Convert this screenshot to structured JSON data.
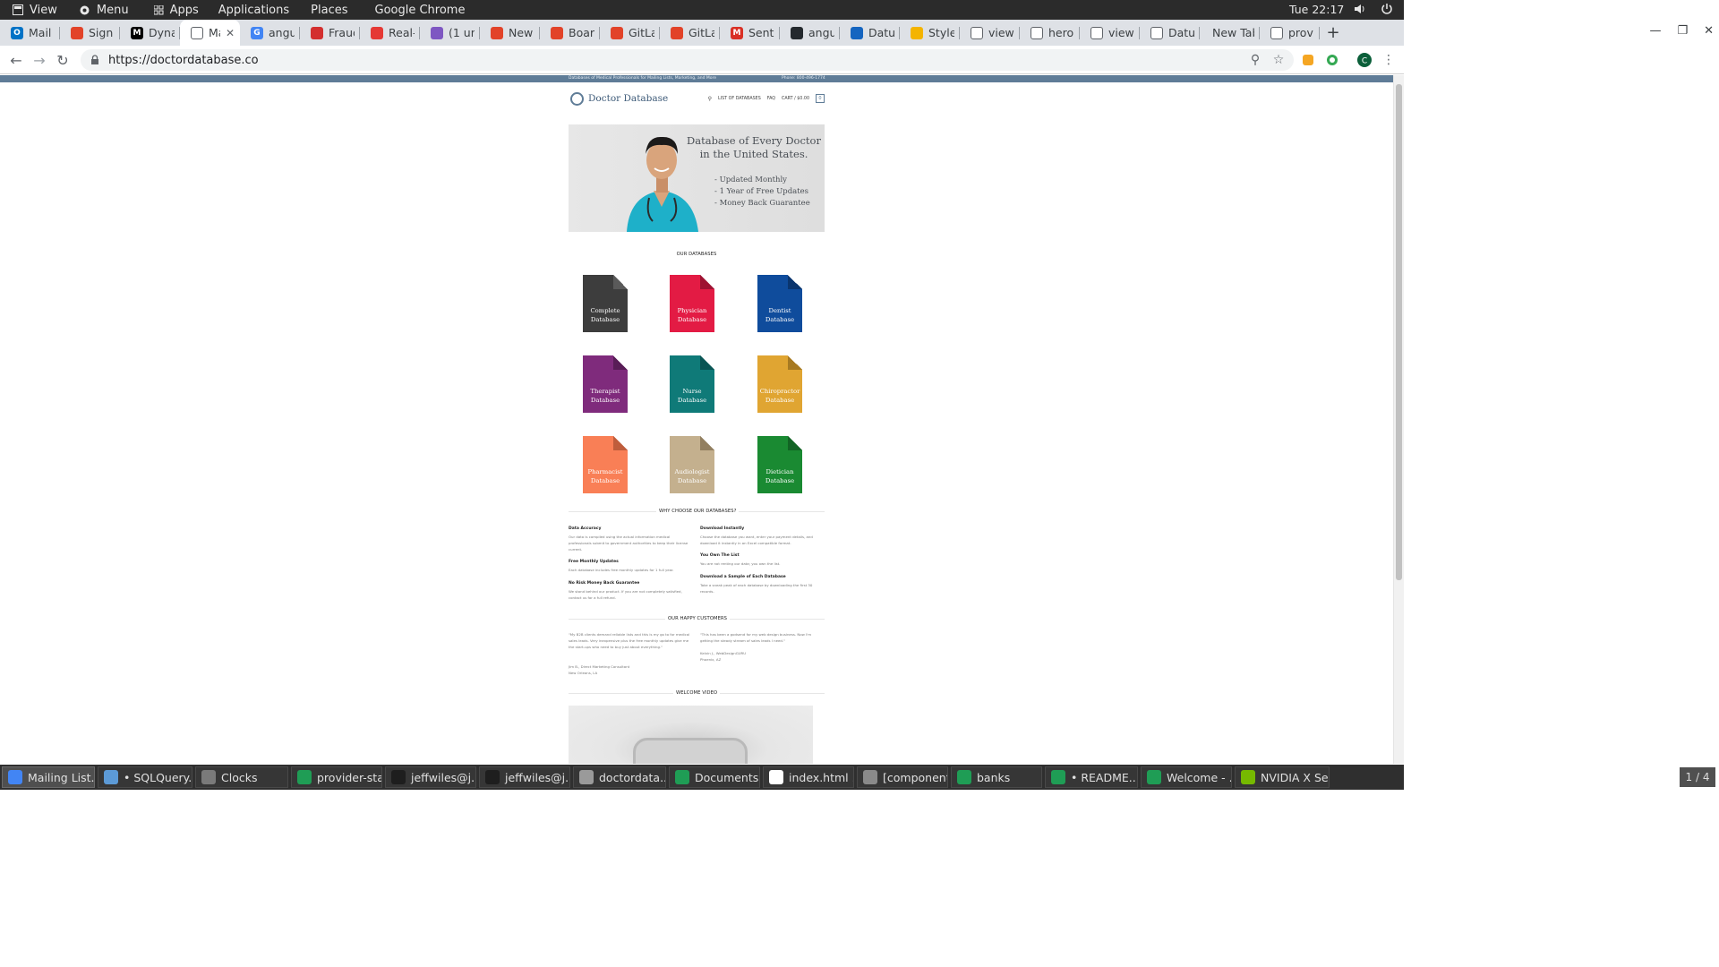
{
  "system_panel": {
    "items": [
      "View",
      "Menu",
      "Apps",
      "Applications",
      "Places",
      "Google Chrome"
    ],
    "clock": "Tue 22:17"
  },
  "tabs": [
    {
      "title": "Mail -",
      "color": "#0072c6",
      "glyph": "O"
    },
    {
      "title": "Sign u",
      "color": "#e24329",
      "glyph": ""
    },
    {
      "title": "Dynar",
      "color": "#000000",
      "glyph": "M"
    },
    {
      "title": "Ma",
      "color": "#ffffff",
      "glyph": "",
      "active": true
    },
    {
      "title": "angul",
      "color": "#4285f4",
      "glyph": "G"
    },
    {
      "title": "Fraud",
      "color": "#d32f2f",
      "glyph": ""
    },
    {
      "title": "Real-\\",
      "color": "#e53935",
      "glyph": ""
    },
    {
      "title": "(1 unr",
      "color": "#7e57c2",
      "glyph": ""
    },
    {
      "title": "New S",
      "color": "#e24329",
      "glyph": ""
    },
    {
      "title": "Board",
      "color": "#e24329",
      "glyph": ""
    },
    {
      "title": "GitLal",
      "color": "#e24329",
      "glyph": ""
    },
    {
      "title": "GitLal",
      "color": "#e24329",
      "glyph": ""
    },
    {
      "title": "Sent I",
      "color": "#d93025",
      "glyph": "M"
    },
    {
      "title": "angul",
      "color": "#24292e",
      "glyph": ""
    },
    {
      "title": "Datun",
      "color": "#1565c0",
      "glyph": ""
    },
    {
      "title": "Style",
      "color": "#f4b400",
      "glyph": ""
    },
    {
      "title": "view-",
      "color": "#ffffff",
      "glyph": ""
    },
    {
      "title": "hero-",
      "color": "#ffffff",
      "glyph": ""
    },
    {
      "title": "view-",
      "color": "#ffffff",
      "glyph": ""
    },
    {
      "title": "Datun",
      "color": "#ffffff",
      "glyph": ""
    },
    {
      "title": "New Tab",
      "color": "none",
      "glyph": ""
    },
    {
      "title": "provic",
      "color": "#ffffff",
      "glyph": ""
    }
  ],
  "omnibox": {
    "url": "https://doctordatabase.co"
  },
  "site": {
    "topbar_left": "Databases of Medical Professionals for Mailing Lists, Marketing, and More",
    "topbar_right": "Phone: 800-496-1774",
    "logo": "Doctor Database",
    "nav": [
      "LIST OF DATABASES",
      "FAQ",
      "CART / $0.00"
    ],
    "cart_count": "0",
    "hero": {
      "title": "Database of Every Doctor in the United States.",
      "bullets": [
        "- Updated Monthly",
        "- 1 Year of Free Updates",
        "- Money Back Guarantee"
      ]
    },
    "our_databases_title": "OUR DATABASES",
    "databases": [
      {
        "line1": "Complete",
        "line2": "Database",
        "color": "#3d3d3d",
        "shade": "#5a5a5a"
      },
      {
        "line1": "Physician",
        "line2": "Database",
        "color": "#e31b44",
        "shade": "#9e1232"
      },
      {
        "line1": "Dentist",
        "line2": "Database",
        "color": "#0f4c9c",
        "shade": "#0a356e"
      },
      {
        "line1": "Therapist",
        "line2": "Database",
        "color": "#7f2b7c",
        "shade": "#591d57"
      },
      {
        "line1": "Nurse",
        "line2": "Database",
        "color": "#0f7a78",
        "shade": "#0a5554"
      },
      {
        "line1": "Chiropractor",
        "line2": "Database",
        "color": "#e0a532",
        "shade": "#a77a22"
      },
      {
        "line1": "Pharmacist",
        "line2": "Database",
        "color": "#f97f56",
        "shade": "#bf5d3c"
      },
      {
        "line1": "Audiologist",
        "line2": "Database",
        "color": "#c4b08e",
        "shade": "#927f60"
      },
      {
        "line1": "Dietician",
        "line2": "Database",
        "color": "#1a8a32",
        "shade": "#126424"
      }
    ],
    "why_title": "WHY CHOOSE OUR DATABASES?",
    "features_left": [
      {
        "heading": "Data Accuracy",
        "text": "Our data is compiled using the actual information medical professionals submit to government authorities to keep their license current."
      },
      {
        "heading": "Free Monthly Updates",
        "text": "Each database includes free monthly updates for 1 full year."
      },
      {
        "heading": "No Risk Money Back Guarantee",
        "text": "We stand behind our product. If you are not completely satisfied, contact us for a full refund."
      }
    ],
    "features_right": [
      {
        "heading": "Download Instantly",
        "text": "Choose the database you want, enter your payment details, and download it instantly in an Excel compatible format."
      },
      {
        "heading": "You Own The List",
        "text": "You are not renting our data; you own the list."
      },
      {
        "heading": "Download a Sample of Each Database",
        "text": "Take a sneak peak of each database by downloading the first 30 records."
      }
    ],
    "customers_title": "OUR HAPPY CUSTOMERS",
    "testimonials": [
      {
        "quote": "\"My B2B clients demand reliable lists and this is my go to for medical sales leads. Very inexpensive plus the free monthly updates give me the start-ups who need to buy just about everything.\"",
        "author": "Jim B., Direct Marketing Consultant",
        "location": "New Orleans, LA"
      },
      {
        "quote": "\"This has been a godsend for my web design business. Now I'm getting the steady stream of sales leads I need.\"",
        "author": "Kelvin J., WebDesignGURU",
        "location": "Phoenix, AZ"
      }
    ],
    "video_title": "WELCOME VIDEO"
  },
  "taskbar": {
    "items": [
      {
        "label": "Mailing List...",
        "color": "#4285f4",
        "active": true
      },
      {
        "label": "• SQLQuery...",
        "color": "#5c9ad6"
      },
      {
        "label": "Clocks",
        "color": "#7a7a7a"
      },
      {
        "label": "provider-sta...",
        "color": "#1f9d55"
      },
      {
        "label": "jeffwiles@j...",
        "color": "#1e1e1e"
      },
      {
        "label": "jeffwiles@j...",
        "color": "#1e1e1e"
      },
      {
        "label": "doctordata...",
        "color": "#9a9a9a"
      },
      {
        "label": "Documents",
        "color": "#1f9d55"
      },
      {
        "label": "index.html ...",
        "color": "#ffffff"
      },
      {
        "label": "[components]",
        "color": "#8a8a8a"
      },
      {
        "label": "banks",
        "color": "#1f9d55"
      },
      {
        "label": "• README....",
        "color": "#1f9d55"
      },
      {
        "label": "Welcome - ...",
        "color": "#1f9d55"
      },
      {
        "label": "NVIDIA X Se...",
        "color": "#76b900"
      }
    ],
    "workspace": "1 / 4"
  }
}
